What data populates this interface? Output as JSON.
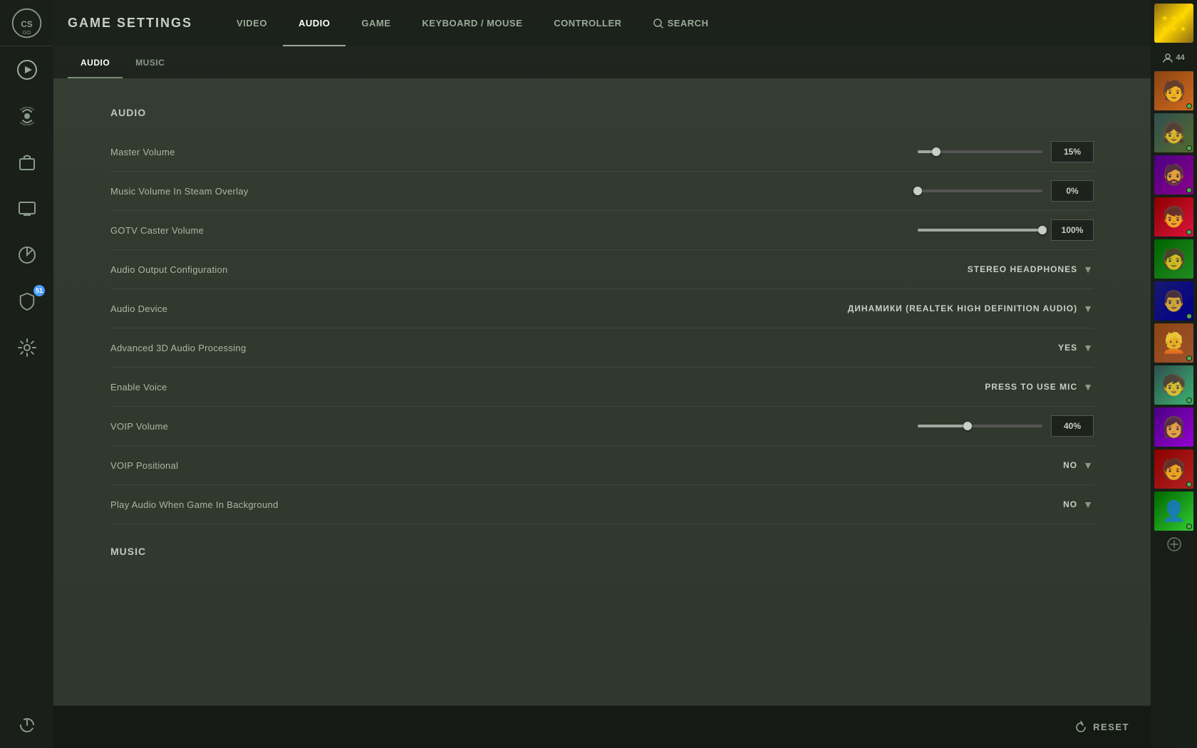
{
  "app": {
    "title": "GAME SETTINGS"
  },
  "nav": {
    "tabs": [
      {
        "id": "video",
        "label": "Video",
        "active": false
      },
      {
        "id": "audio",
        "label": "Audio",
        "active": true
      },
      {
        "id": "game",
        "label": "Game",
        "active": false
      },
      {
        "id": "keyboard-mouse",
        "label": "Keyboard / Mouse",
        "active": false
      },
      {
        "id": "controller",
        "label": "Controller",
        "active": false
      }
    ],
    "search_label": "Search"
  },
  "sub_tabs": [
    {
      "id": "audio",
      "label": "Audio",
      "active": true
    },
    {
      "id": "music",
      "label": "Music",
      "active": false
    }
  ],
  "sections": [
    {
      "title": "Audio",
      "settings": [
        {
          "label": "Master Volume",
          "type": "slider",
          "value": "15%",
          "percent": 15
        },
        {
          "label": "Music Volume In Steam Overlay",
          "type": "slider",
          "value": "0%",
          "percent": 0
        },
        {
          "label": "GOTV Caster Volume",
          "type": "slider",
          "value": "100%",
          "percent": 100
        },
        {
          "label": "Audio Output Configuration",
          "type": "dropdown",
          "value": "STEREO HEADPHONES"
        },
        {
          "label": "Audio Device",
          "type": "dropdown",
          "value": "ДИНАМИКИ (REALTEK HIGH DEFINITION AUDIO)"
        },
        {
          "label": "Advanced 3D Audio Processing",
          "type": "dropdown",
          "value": "YES"
        },
        {
          "label": "Enable Voice",
          "type": "dropdown",
          "value": "PRESS TO USE MIC"
        },
        {
          "label": "VOIP Volume",
          "type": "slider",
          "value": "40%",
          "percent": 40
        },
        {
          "label": "VOIP Positional",
          "type": "dropdown",
          "value": "NO"
        },
        {
          "label": "Play Audio When Game In Background",
          "type": "dropdown",
          "value": "NO"
        }
      ]
    },
    {
      "title": "Music",
      "settings": []
    }
  ],
  "footer": {
    "reset_label": "RESET"
  },
  "sidebar_icons": [
    {
      "name": "play-icon",
      "symbol": "▶",
      "active": true
    },
    {
      "name": "broadcast-icon",
      "symbol": "📡",
      "active": false
    },
    {
      "name": "inventory-icon",
      "symbol": "🎒",
      "active": false
    },
    {
      "name": "tv-icon",
      "symbol": "📺",
      "active": false
    },
    {
      "name": "stats-icon",
      "symbol": "⚡",
      "active": false
    },
    {
      "name": "shield-icon",
      "symbol": "🛡",
      "active": false,
      "badge": "51"
    },
    {
      "name": "settings-icon",
      "symbol": "⚙",
      "active": false
    }
  ],
  "friends": {
    "count": "44",
    "avatars": [
      {
        "color": "avatar-color-1",
        "emoji": "👤"
      },
      {
        "color": "avatar-color-2",
        "emoji": "👤"
      },
      {
        "color": "avatar-color-3",
        "emoji": "👤"
      },
      {
        "color": "avatar-color-4",
        "emoji": "👤"
      },
      {
        "color": "avatar-color-5",
        "emoji": "👤"
      },
      {
        "color": "avatar-color-6",
        "emoji": "👤"
      },
      {
        "color": "avatar-color-7",
        "emoji": "👤"
      },
      {
        "color": "avatar-color-8",
        "emoji": "👤"
      },
      {
        "color": "avatar-color-9",
        "emoji": "👤"
      },
      {
        "color": "avatar-color-10",
        "emoji": "👤"
      },
      {
        "color": "avatar-color-11",
        "emoji": "👤"
      }
    ]
  }
}
